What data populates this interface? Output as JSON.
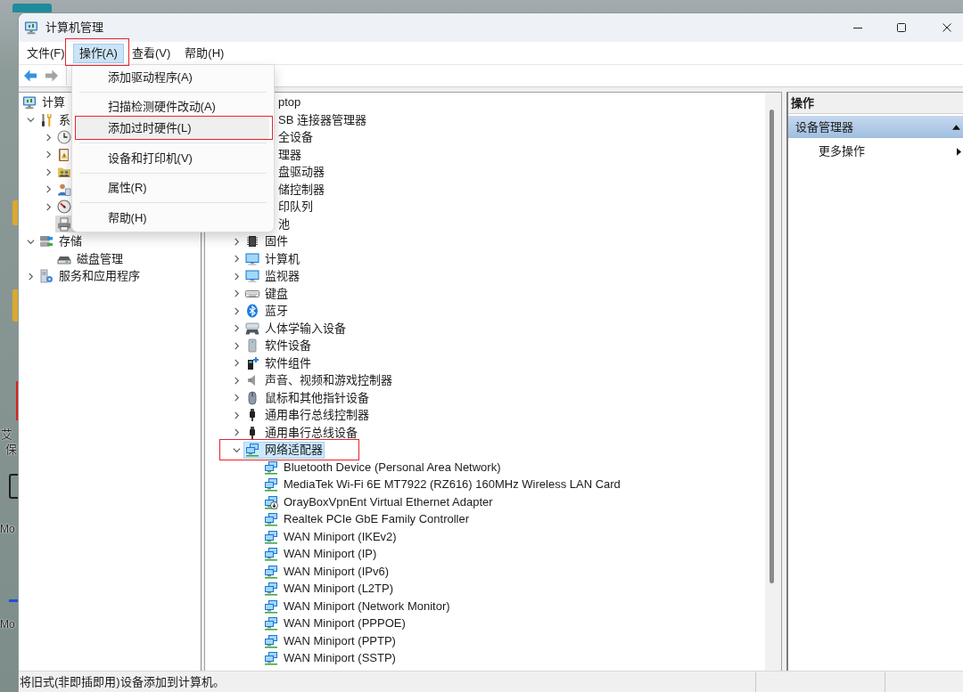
{
  "desktop": {
    "icon_labels": [
      "艾",
      "保",
      "Mo",
      "Mo"
    ]
  },
  "window": {
    "title": "计算机管理"
  },
  "menus": [
    {
      "label": "文件(F)",
      "selected": false,
      "highlighted": false
    },
    {
      "label": "操作(A)",
      "selected": true,
      "highlighted": true
    },
    {
      "label": "查看(V)",
      "selected": false,
      "highlighted": false
    },
    {
      "label": "帮助(H)",
      "selected": false,
      "highlighted": false
    }
  ],
  "toolbar": [
    {
      "disabled": false
    },
    {
      "disabled": true
    }
  ],
  "open_menu": {
    "groups": [
      {
        "items": [
          {
            "label": "添加驱动程序(A)",
            "selected": false,
            "highlighted": false
          }
        ]
      },
      {
        "items": [
          {
            "label": "扫描检测硬件改动(A)",
            "selected": false,
            "highlighted": false
          },
          {
            "label": "添加过时硬件(L)",
            "selected": true,
            "highlighted": true
          }
        ]
      },
      {
        "items": [
          {
            "label": "设备和打印机(V)",
            "selected": false,
            "highlighted": false
          }
        ]
      },
      {
        "items": [
          {
            "label": "属性(R)",
            "selected": false,
            "highlighted": false
          }
        ]
      },
      {
        "items": [
          {
            "label": "帮助(H)",
            "selected": false,
            "highlighted": false
          }
        ]
      }
    ]
  },
  "console_tree": {
    "label": "计算",
    "selected": false,
    "children": [
      {
        "label": "系",
        "expanded": true,
        "selected": false,
        "children": [
          {
            "expanded": false,
            "selected": false
          },
          {
            "expanded": false,
            "selected": false
          },
          {
            "expanded": false,
            "selected": false
          },
          {
            "expanded": false,
            "selected": false
          },
          {
            "expanded": false,
            "selected": false
          },
          {
            "selected": true
          }
        ]
      },
      {
        "label": "存储",
        "expanded": true,
        "selected": false,
        "children": [
          {
            "label": "磁盘管理",
            "selected": false
          }
        ]
      },
      {
        "label": "服务和应用程序",
        "expanded": false,
        "selected": false
      }
    ]
  },
  "device_tree": {
    "kind": "covered",
    "label": "ptop",
    "children": [
      {
        "kind": "covered",
        "label": "SB 连接器管理器"
      },
      {
        "kind": "covered",
        "label": "全设备"
      },
      {
        "kind": "covered",
        "label": "理器"
      },
      {
        "kind": "covered",
        "label": "盘驱动器"
      },
      {
        "kind": "covered",
        "label": "储控制器"
      },
      {
        "kind": "covered",
        "label": "印队列"
      },
      {
        "kind": "covered",
        "label": "池"
      },
      {
        "kind": "category",
        "label": "固件",
        "expanded": false,
        "selected": false,
        "highlighted": false
      },
      {
        "kind": "category",
        "label": "计算机",
        "expanded": false,
        "selected": false,
        "highlighted": false
      },
      {
        "kind": "category",
        "label": "监视器",
        "expanded": false,
        "selected": false,
        "highlighted": false
      },
      {
        "kind": "category",
        "label": "键盘",
        "expanded": false,
        "selected": false,
        "highlighted": false
      },
      {
        "kind": "category",
        "label": "蓝牙",
        "expanded": false,
        "selected": false,
        "highlighted": false
      },
      {
        "kind": "category",
        "label": "人体学输入设备",
        "expanded": false,
        "selected": false,
        "highlighted": false
      },
      {
        "kind": "category",
        "label": "软件设备",
        "expanded": false,
        "selected": false,
        "highlighted": false
      },
      {
        "kind": "category",
        "label": "软件组件",
        "expanded": false,
        "selected": false,
        "highlighted": false
      },
      {
        "kind": "category",
        "label": "声音、视频和游戏控制器",
        "expanded": false,
        "selected": false,
        "highlighted": false
      },
      {
        "kind": "category",
        "label": "鼠标和其他指针设备",
        "expanded": false,
        "selected": false,
        "highlighted": false
      },
      {
        "kind": "category",
        "label": "通用串行总线控制器",
        "expanded": false,
        "selected": false,
        "highlighted": false
      },
      {
        "kind": "category",
        "label": "通用串行总线设备",
        "expanded": false,
        "selected": false,
        "highlighted": false
      },
      {
        "kind": "category",
        "label": "网络适配器",
        "expanded": true,
        "selected": true,
        "highlighted": true,
        "children": [
          {
            "label": "Bluetooth Device (Personal Area Network)",
            "disabled": false
          },
          {
            "label": "MediaTek Wi-Fi 6E MT7922 (RZ616) 160MHz Wireless LAN Card",
            "disabled": false
          },
          {
            "label": "OrayBoxVpnEnt Virtual Ethernet Adapter",
            "disabled": true
          },
          {
            "label": "Realtek PCIe GbE Family Controller",
            "disabled": false
          },
          {
            "label": "WAN Miniport (IKEv2)",
            "disabled": false
          },
          {
            "label": "WAN Miniport (IP)",
            "disabled": false
          },
          {
            "label": "WAN Miniport (IPv6)",
            "disabled": false
          },
          {
            "label": "WAN Miniport (L2TP)",
            "disabled": false
          },
          {
            "label": "WAN Miniport (Network Monitor)",
            "disabled": false
          },
          {
            "label": "WAN Miniport (PPPOE)",
            "disabled": false
          },
          {
            "label": "WAN Miniport (PPTP)",
            "disabled": false
          },
          {
            "label": "WAN Miniport (SSTP)",
            "disabled": false
          }
        ]
      }
    ]
  },
  "actions_pane": {
    "title": "操作",
    "groups": [
      {
        "label": "设备管理器",
        "expanded": true,
        "items": [
          {
            "label": "更多操作"
          }
        ]
      }
    ]
  },
  "status_bar": {
    "text": "将旧式(非即插即用)设备添加到计算机。"
  }
}
